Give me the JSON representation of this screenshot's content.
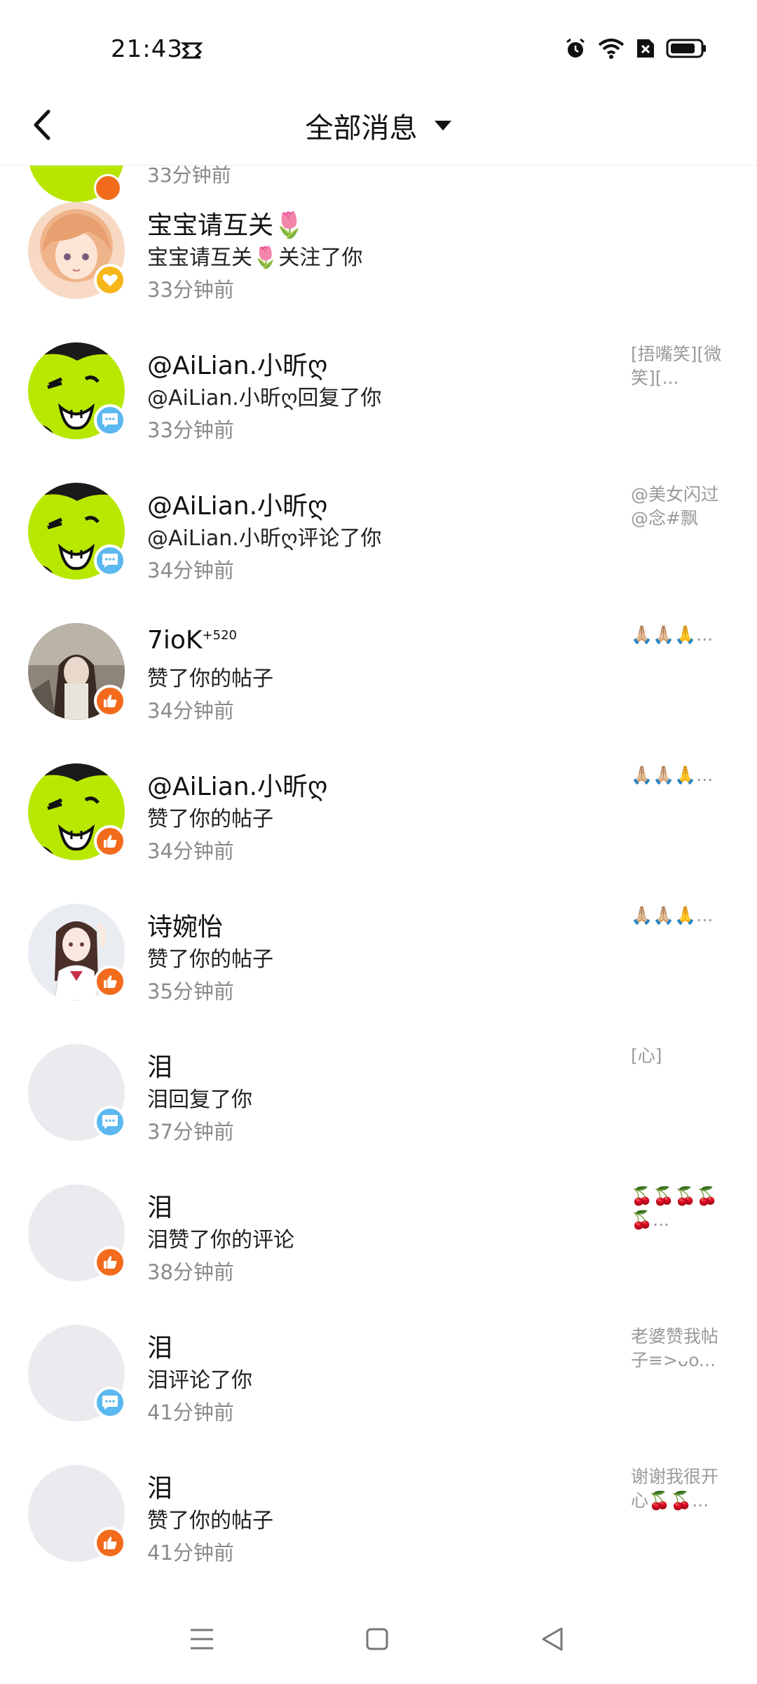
{
  "status_bar": {
    "time": "21:43"
  },
  "header": {
    "title": "全部消息"
  },
  "partial_item": {
    "time": "33分钟前"
  },
  "messages": [
    {
      "name": "宝宝请互关🌷",
      "action": "宝宝请互关🌷关注了你",
      "time": "33分钟前",
      "preview": "",
      "badge": "follow",
      "avatar": "girl-light"
    },
    {
      "name": "@AiLian.小昕ღ",
      "action": "@AiLian.小昕ღ回复了你",
      "time": "33分钟前",
      "preview": "[捂嘴笑][微笑][...",
      "badge": "comment",
      "avatar": "green"
    },
    {
      "name": "@AiLian.小昕ღ",
      "action": "@AiLian.小昕ღ评论了你",
      "time": "34分钟前",
      "preview": "@美女闪过@念#飘过...",
      "badge": "comment",
      "avatar": "green"
    },
    {
      "name": "7ioK",
      "name_sup": "+520",
      "action": "赞了你的帖子",
      "time": "34分钟前",
      "preview": "🙏🏼🙏🏼🙏...",
      "badge": "like",
      "avatar": "girl-dark"
    },
    {
      "name": "@AiLian.小昕ღ",
      "action": "赞了你的帖子",
      "time": "34分钟前",
      "preview": "🙏🏼🙏🏼🙏...",
      "badge": "like",
      "avatar": "green"
    },
    {
      "name": "诗婉怡",
      "action": "赞了你的帖子",
      "time": "35分钟前",
      "preview": "🙏🏼🙏🏼🙏...",
      "badge": "like",
      "avatar": "anime"
    },
    {
      "name": "泪",
      "action": "泪回复了你",
      "time": "37分钟前",
      "preview": "[心]",
      "badge": "comment",
      "avatar": "blank"
    },
    {
      "name": "泪",
      "action": "泪赞了你的评论",
      "time": "38分钟前",
      "preview": "🍒🍒🍒🍒🍒...",
      "badge": "like",
      "avatar": "blank"
    },
    {
      "name": "泪",
      "action": "泪评论了你",
      "time": "41分钟前",
      "preview": "老婆赞我帖子≡>ᴗo...",
      "badge": "comment",
      "avatar": "blank"
    },
    {
      "name": "泪",
      "action": "赞了你的帖子",
      "time": "41分钟前",
      "preview": "谢谢我很开心🍒🍒...",
      "badge": "like",
      "avatar": "blank"
    }
  ],
  "colors": {
    "like_badge": "#f26b1d",
    "comment_badge": "#5bb8f0",
    "follow_badge": "#f7b718",
    "muted_text": "#8a8a8a"
  },
  "icons": {
    "back": "chevron-left-icon",
    "dropdown": "caret-down-icon",
    "like": "thumbs-up-icon",
    "comment": "chat-bubble-icon",
    "follow": "heart-icon"
  }
}
